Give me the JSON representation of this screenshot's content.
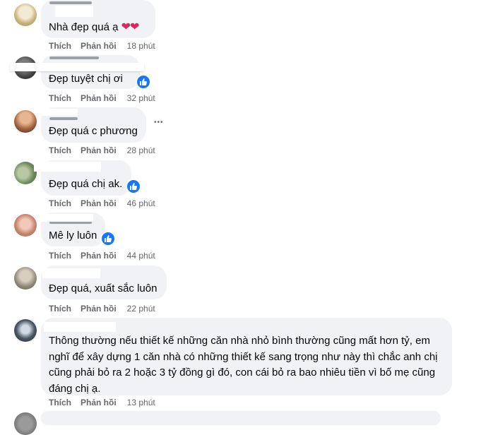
{
  "comments": [
    {
      "text": "Nhà đẹp quá ạ",
      "emoji": "❤❤",
      "like_label": "Thích",
      "reply_label": "Phản hồi",
      "time": "18 phút"
    },
    {
      "text": "Đẹp tuyệt chị ơi",
      "like_label": "Thích",
      "reply_label": "Phản hồi",
      "time": "32 phút"
    },
    {
      "text": "Đẹp quá c phương",
      "like_label": "Thích",
      "reply_label": "Phản hồi",
      "time": "28 phút",
      "more_label": "•••"
    },
    {
      "text": "Đẹp quá chị ak.",
      "like_label": "Thích",
      "reply_label": "Phản hồi",
      "time": "46 phút"
    },
    {
      "text": "Mê ly luôn",
      "like_label": "Thích",
      "reply_label": "Phản hồi",
      "time": "44 phút"
    },
    {
      "text": "Đẹp quá, xuất sắc luôn",
      "like_label": "Thích",
      "reply_label": "Phản hồi",
      "time": "22 phút"
    },
    {
      "text": "Thông thường nếu thiết kế những căn nhà nhỏ bình thường cũng mất hơn tỷ, em nghĩ để xây dựng 1 căn nhà có những thiết kế sang trọng như này thì chắc anh chị cũng phải bỏ ra 2 hoặc 3 tỷ đồng gì đó, con cái bỏ ra bao nhiêu tiền vì bố mẹ cũng đáng chị ạ.",
      "like_label": "Thích",
      "reply_label": "Phản hồi",
      "time": "13 phút"
    }
  ],
  "icons": {
    "like_reaction": "thumbs-up-icon",
    "heart": "heart-icon",
    "more": "more-icon"
  },
  "colors": {
    "bubble": "#f0f2f5",
    "meta": "#65676b",
    "like_blue": "#1877f2",
    "heart": "#e0245e"
  }
}
